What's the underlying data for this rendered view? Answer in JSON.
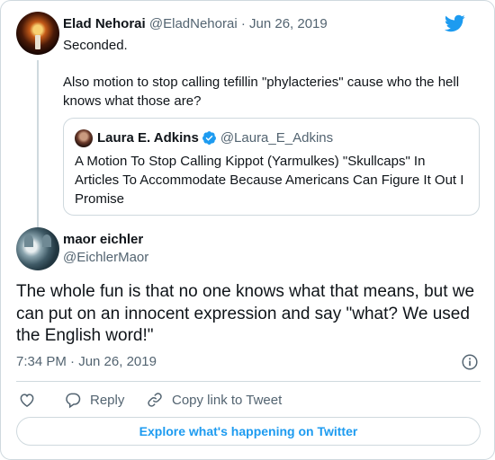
{
  "parent_tweet": {
    "name": "Elad Nehorai",
    "handle": "@EladNehorai",
    "separator": "·",
    "date": "Jun 26, 2019",
    "paragraphs": [
      "Seconded.",
      "Also motion to stop calling tefillin \"phylacteries\" cause who the hell knows what those are?"
    ]
  },
  "quote_tweet": {
    "name": "Laura E. Adkins",
    "handle": "@Laura_E_Adkins",
    "text": "A Motion To Stop Calling Kippot (Yarmulkes) \"Skullcaps\" In Articles To Accommodate Because Americans Can Figure It Out I Promise"
  },
  "main_tweet": {
    "name": "maor eichler",
    "handle": "@EichlerMaor",
    "text": "The whole fun is that no one knows what that means, but we can put on an innocent expression and say \"what? We used the English word!\"",
    "timestamp": "7:34 PM · Jun 26, 2019"
  },
  "actions": {
    "reply_label": "Reply",
    "copy_link_label": "Copy link to Tweet"
  },
  "explore_label": "Explore what's happening on Twitter",
  "icons": {
    "brand": "twitter-bird-icon",
    "verified": "verified-badge-icon",
    "info": "info-icon",
    "like": "heart-icon",
    "reply": "reply-bubble-icon",
    "copy_link": "link-icon"
  },
  "colors": {
    "accent": "#1d9bf0",
    "text": "#0f1419",
    "secondary": "#536471",
    "border": "#cfd9de"
  }
}
